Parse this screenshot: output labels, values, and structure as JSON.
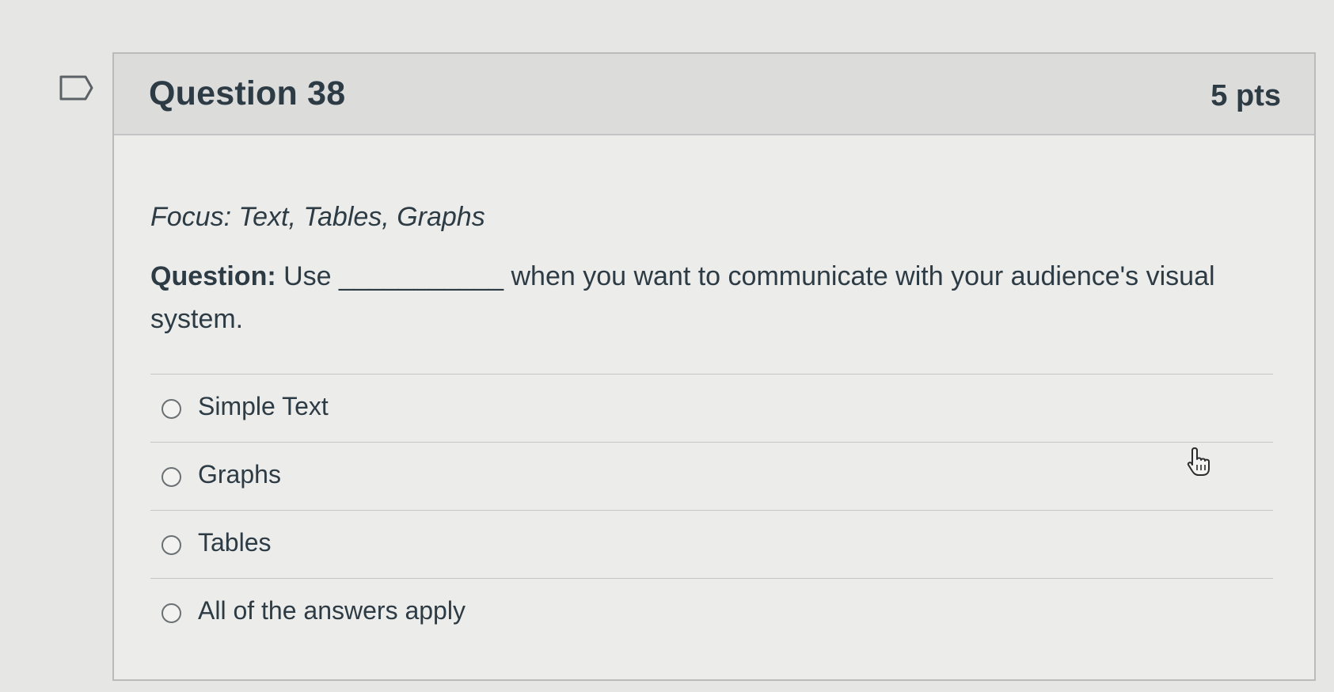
{
  "question": {
    "title": "Question 38",
    "points": "5 pts",
    "focus": "Focus: Text, Tables, Graphs",
    "prompt_label": "Question:",
    "prompt_text": "Use ___________ when you want to communicate with your audience's visual system."
  },
  "answers": [
    {
      "label": "Simple Text"
    },
    {
      "label": "Graphs"
    },
    {
      "label": "Tables"
    },
    {
      "label": "All of the answers apply"
    }
  ],
  "icons": {
    "flag": "flag-outline-icon",
    "cursor": "hand-pointer-icon"
  },
  "colors": {
    "header_bg": "#dcdcdb",
    "body_bg": "#ececea",
    "text": "#2d3b45",
    "border": "#b9bbbd"
  }
}
